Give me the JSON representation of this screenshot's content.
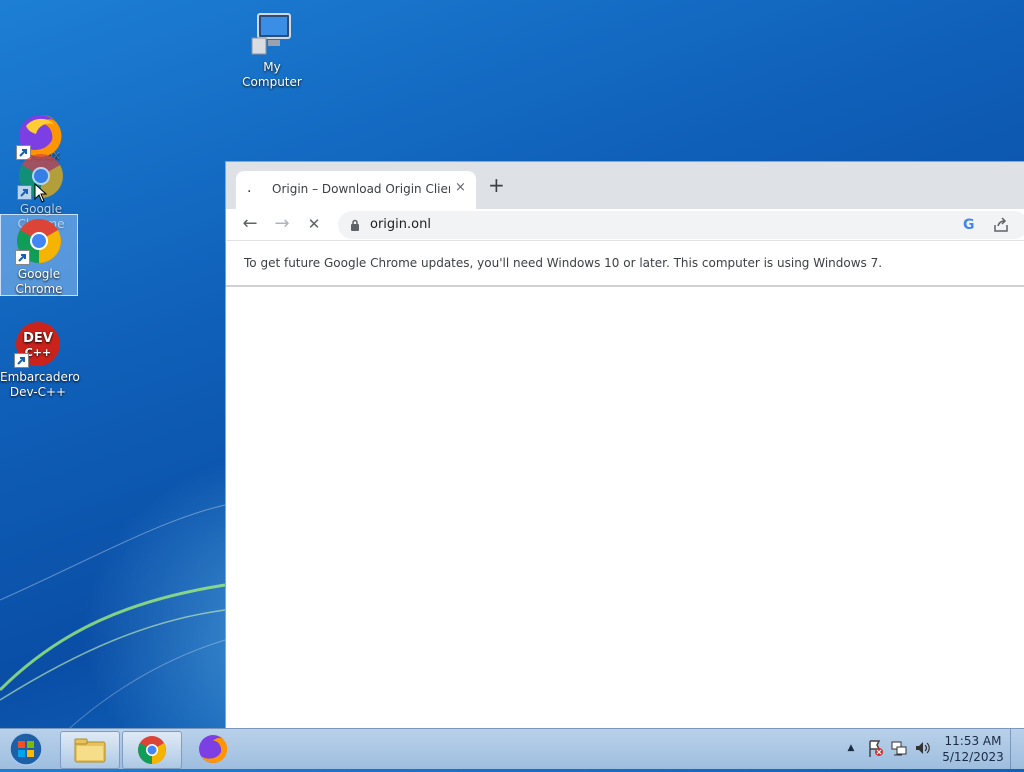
{
  "desktop": {
    "icons": {
      "my_computer": "My Computer",
      "firefox": "Firefox",
      "chrome_ghost": "Google Chrome",
      "chrome": "Google Chrome",
      "devcpp": "Embarcadero Dev-C++"
    }
  },
  "browser": {
    "tab": {
      "dot": ".",
      "title": "Origin – Download Origin Client",
      "close": "×"
    },
    "new_tab": "+",
    "nav": {
      "back": "←",
      "forward": "→",
      "stop": "✕"
    },
    "url": "origin.onl",
    "google_letter": "G",
    "infobar_text": "To get future Google Chrome updates, you'll need Windows 10 or later. This computer is using Windows 7."
  },
  "taskbar": {
    "clock_time": "11:53 AM",
    "clock_date": "5/12/2023",
    "tray_arrow": "▲"
  },
  "colors": {
    "chrome_red": "#db4437",
    "chrome_yellow": "#f4b400",
    "chrome_green": "#0f9d58",
    "chrome_blue": "#4285f4"
  }
}
